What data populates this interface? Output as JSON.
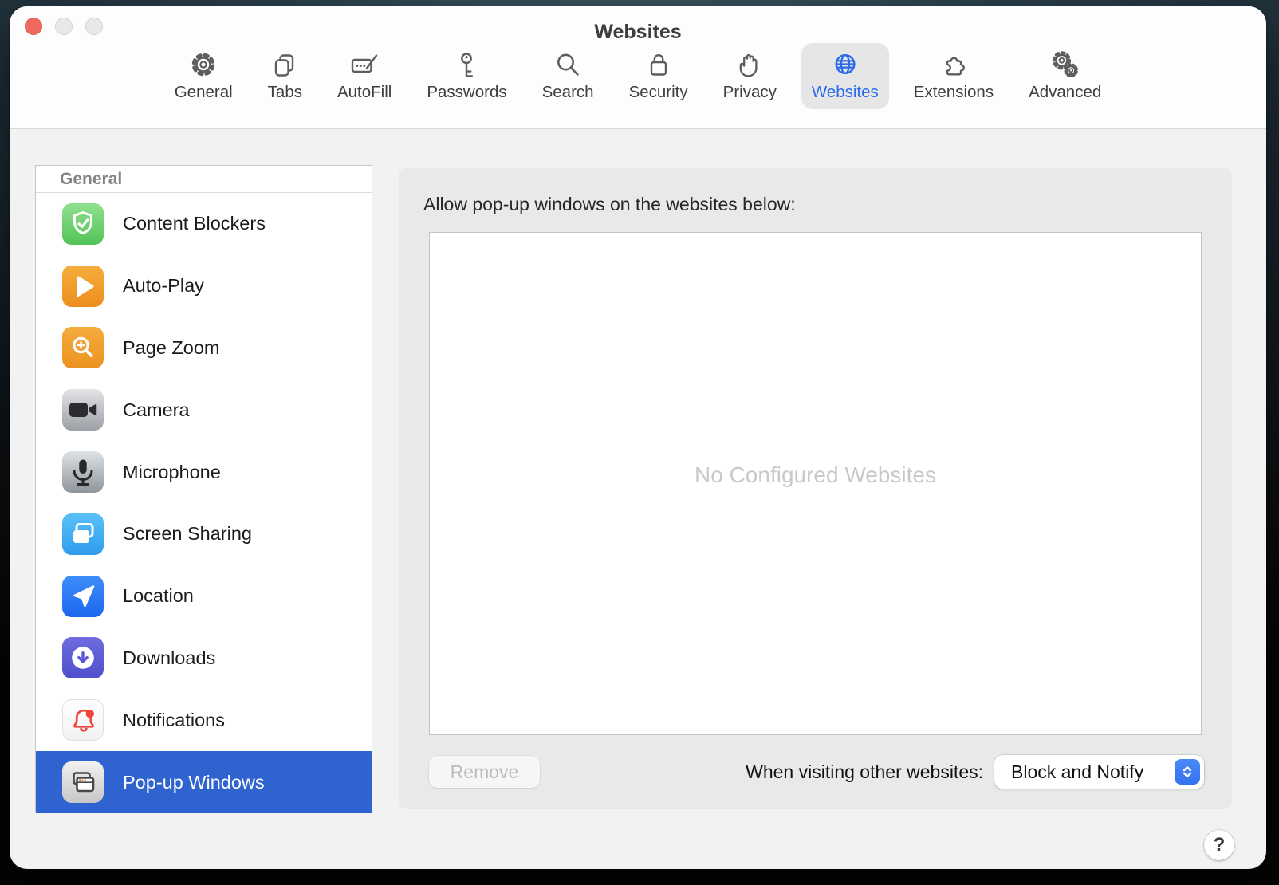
{
  "window": {
    "title": "Websites",
    "controls": [
      {
        "name": "close",
        "color": "#ee6a5f"
      },
      {
        "name": "minimize",
        "color": "#e9e8e8"
      },
      {
        "name": "zoom",
        "color": "#e9e8e8"
      }
    ]
  },
  "toolbar": {
    "tabs": [
      {
        "label": "General",
        "icon": "gear-icon",
        "selected": false
      },
      {
        "label": "Tabs",
        "icon": "tabs-icon",
        "selected": false
      },
      {
        "label": "AutoFill",
        "icon": "autofill-icon",
        "selected": false
      },
      {
        "label": "Passwords",
        "icon": "key-icon",
        "selected": false
      },
      {
        "label": "Search",
        "icon": "search-icon",
        "selected": false
      },
      {
        "label": "Security",
        "icon": "lock-icon",
        "selected": false
      },
      {
        "label": "Privacy",
        "icon": "hand-icon",
        "selected": false
      },
      {
        "label": "Websites",
        "icon": "globe-icon",
        "selected": true
      },
      {
        "label": "Extensions",
        "icon": "puzzle-icon",
        "selected": false
      },
      {
        "label": "Advanced",
        "icon": "gears-icon",
        "selected": false
      }
    ]
  },
  "sidebar": {
    "header": "General",
    "items": [
      {
        "label": "Content Blockers",
        "icon": "shield-check-icon",
        "selected": false
      },
      {
        "label": "Auto-Play",
        "icon": "play-icon",
        "selected": false
      },
      {
        "label": "Page Zoom",
        "icon": "magnifier-plus-icon",
        "selected": false
      },
      {
        "label": "Camera",
        "icon": "camera-icon",
        "selected": false
      },
      {
        "label": "Microphone",
        "icon": "microphone-icon",
        "selected": false
      },
      {
        "label": "Screen Sharing",
        "icon": "screen-sharing-icon",
        "selected": false
      },
      {
        "label": "Location",
        "icon": "location-arrow-icon",
        "selected": false
      },
      {
        "label": "Downloads",
        "icon": "download-circle-icon",
        "selected": false
      },
      {
        "label": "Notifications",
        "icon": "bell-badge-icon",
        "selected": false
      },
      {
        "label": "Pop-up Windows",
        "icon": "popup-windows-icon",
        "selected": true
      }
    ]
  },
  "main": {
    "heading": "Allow pop-up windows on the websites below:",
    "list_placeholder": "No Configured Websites",
    "remove_button": "Remove",
    "when_visiting_label": "When visiting other websites:",
    "other_websites_policy": "Block and Notify",
    "help_button": "?"
  },
  "colors": {
    "tab_selected_accent": "#2a6bea",
    "sidebar_selection": "#2e63d0",
    "stepper_blue": "#3d7bf4",
    "notification_red": "#ee453b"
  }
}
